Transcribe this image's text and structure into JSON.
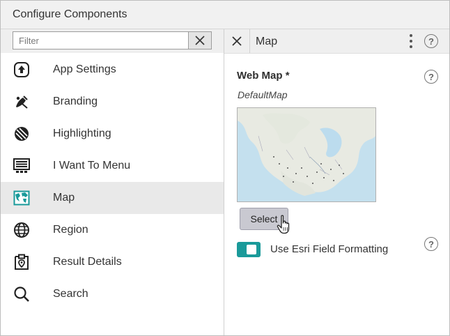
{
  "window": {
    "title": "Configure Components"
  },
  "filter": {
    "placeholder": "Filter",
    "value": ""
  },
  "nav": {
    "items": [
      {
        "label": "App Settings",
        "icon": "app-settings-icon",
        "selected": false
      },
      {
        "label": "Branding",
        "icon": "branding-icon",
        "selected": false
      },
      {
        "label": "Highlighting",
        "icon": "highlighting-icon",
        "selected": false
      },
      {
        "label": "I Want To Menu",
        "icon": "menu-icon",
        "selected": false
      },
      {
        "label": "Map",
        "icon": "map-icon",
        "selected": true
      },
      {
        "label": "Region",
        "icon": "globe-icon",
        "selected": false
      },
      {
        "label": "Result Details",
        "icon": "result-details-icon",
        "selected": false
      },
      {
        "label": "Search",
        "icon": "search-icon",
        "selected": false
      }
    ]
  },
  "panel": {
    "title": "Map",
    "web_map_label": "Web Map *",
    "web_map_value": "DefaultMap",
    "select_label": "Select",
    "toggle_label": "Use Esri Field Formatting",
    "toggle_on": true,
    "help_glyph": "?"
  },
  "colors": {
    "accent": "#1a9a9a",
    "map_icon": "#1a9a9a",
    "selected_bg": "#e9e9e9"
  }
}
